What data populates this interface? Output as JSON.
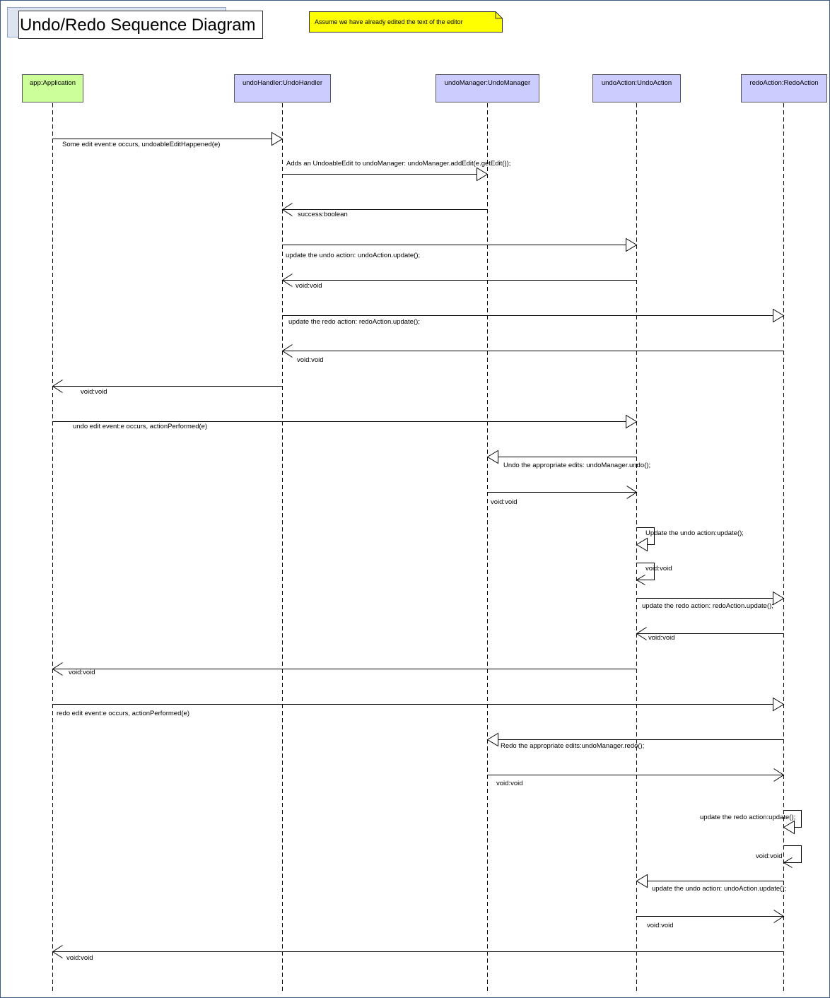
{
  "title": "Undo/Redo Sequence Diagram",
  "note": "Assume we have already edited the text of the editor",
  "colors": {
    "application_head": "#ccff99",
    "object_head": "#ccccff",
    "note": "#ffff00",
    "line": "#000000"
  },
  "participants": [
    {
      "id": "app",
      "label": "app:Application"
    },
    {
      "id": "handler",
      "label": "undoHandler:UndoHandler"
    },
    {
      "id": "manager",
      "label": "undoManager:UndoManager"
    },
    {
      "id": "undo",
      "label": "undoAction:UndoAction"
    },
    {
      "id": "redo",
      "label": "redoAction:RedoAction"
    }
  ],
  "messages": [
    {
      "from": "app",
      "to": "handler",
      "kind": "call",
      "label": "Some edit event:e occurs, undoableEditHappened(e)"
    },
    {
      "from": "handler",
      "to": "manager",
      "kind": "call",
      "label": "Adds an UndoableEdit to undoManager: undoManager.addEdit(e.getEdit());"
    },
    {
      "from": "manager",
      "to": "handler",
      "kind": "return",
      "label": "success:boolean"
    },
    {
      "from": "handler",
      "to": "undo",
      "kind": "call",
      "label": "update the undo action: undoAction.update();"
    },
    {
      "from": "undo",
      "to": "handler",
      "kind": "return",
      "label": "void:void"
    },
    {
      "from": "handler",
      "to": "redo",
      "kind": "call",
      "label": "update the redo action: redoAction.update();"
    },
    {
      "from": "redo",
      "to": "handler",
      "kind": "return",
      "label": "void:void"
    },
    {
      "from": "handler",
      "to": "app",
      "kind": "return",
      "label": "void:void"
    },
    {
      "from": "app",
      "to": "undo",
      "kind": "call",
      "label": "undo edit event:e occurs, actionPerformed(e)"
    },
    {
      "from": "undo",
      "to": "manager",
      "kind": "call",
      "label": "Undo the appropriate edits: undoManager.undo();"
    },
    {
      "from": "manager",
      "to": "undo",
      "kind": "return",
      "label": "void:void"
    },
    {
      "from": "undo",
      "to": "undo",
      "kind": "call",
      "label": "Update the undo action:update();"
    },
    {
      "from": "undo",
      "to": "undo",
      "kind": "return",
      "label": "void:void"
    },
    {
      "from": "undo",
      "to": "redo",
      "kind": "call",
      "label": "update the redo action: redoAction.update();"
    },
    {
      "from": "redo",
      "to": "undo",
      "kind": "return",
      "label": "void:void"
    },
    {
      "from": "undo",
      "to": "app",
      "kind": "return",
      "label": "void:void"
    },
    {
      "from": "app",
      "to": "redo",
      "kind": "call",
      "label": "redo edit event:e occurs, actionPerformed(e)"
    },
    {
      "from": "redo",
      "to": "manager",
      "kind": "call",
      "label": "Redo the appropriate edits:undoManager.redo();"
    },
    {
      "from": "manager",
      "to": "redo",
      "kind": "return",
      "label": "void:void"
    },
    {
      "from": "redo",
      "to": "redo",
      "kind": "call",
      "label": "update the redo action:update();"
    },
    {
      "from": "redo",
      "to": "redo",
      "kind": "return",
      "label": "void:void"
    },
    {
      "from": "redo",
      "to": "undo",
      "kind": "call",
      "label": "update the undo action: undoAction.update();"
    },
    {
      "from": "undo",
      "to": "redo",
      "kind": "return",
      "label": "void:void"
    },
    {
      "from": "redo",
      "to": "app",
      "kind": "return",
      "label": "void:void"
    }
  ]
}
